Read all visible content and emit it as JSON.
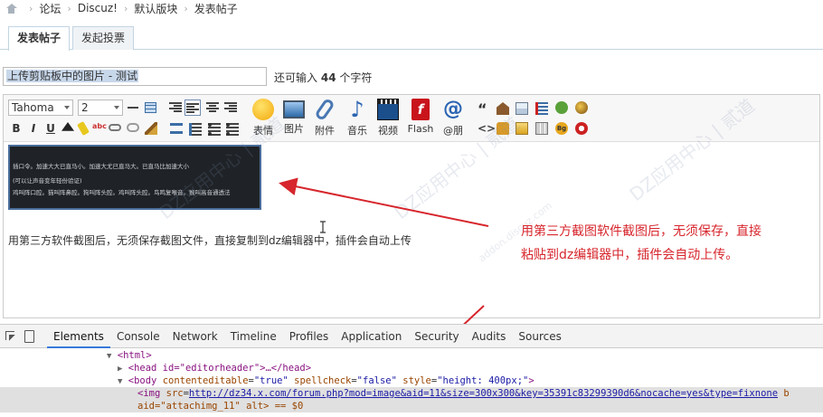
{
  "breadcrumb": {
    "items": [
      "论坛",
      "Discuz!",
      "默认版块",
      "发表帖子"
    ],
    "separator": "›"
  },
  "tabs": [
    {
      "label": "发表帖子",
      "active": true
    },
    {
      "label": "发起投票",
      "active": false
    }
  ],
  "subject": {
    "value": "上传剪贴板中的图片 - 测试",
    "remaining_prefix": "还可输入",
    "remaining_count": "44",
    "remaining_suffix": "个字符"
  },
  "toolbar": {
    "font_family": "Tahoma",
    "font_size": "2",
    "bold": "B",
    "italic": "I",
    "underline": "U",
    "big_buttons": [
      {
        "icon": "smiley-icon",
        "label": "表情"
      },
      {
        "icon": "image-icon",
        "label": "图片"
      },
      {
        "icon": "attachment-icon",
        "label": "附件"
      },
      {
        "icon": "music-icon",
        "label": "音乐"
      },
      {
        "icon": "video-icon",
        "label": "视频"
      },
      {
        "icon": "flash-icon",
        "label": "Flash"
      },
      {
        "icon": "at-icon",
        "label": "@朋"
      }
    ]
  },
  "content": {
    "screenshot_lines": [
      "插口令。加速大大已直马小。加速大尤已直马大。已直马比加速大小",
      "(可以让声音变年轻份验证)",
      "鸡叫阵口腔。猫叫阵鼻腔。狗叫阵头腔。鸡叫阵头腔。鸟鸣复喉音。猴叫高音通透法"
    ],
    "text": "用第三方软件截图后，无须保存截图文件，直接复制到dz编辑器中，插件会自动上传"
  },
  "annotation": {
    "line1": "用第三方截图软件截图后，无须保存，直接",
    "line2": "粘贴到dz编辑器中，插件会自动上传。"
  },
  "watermark": {
    "text": "DZ应用中心 | 贰道",
    "subtext": "addon.discuz.com"
  },
  "devtools": {
    "tabs": [
      "Elements",
      "Console",
      "Network",
      "Timeline",
      "Profiles",
      "Application",
      "Security",
      "Audits",
      "Sources"
    ],
    "active_tab": "Elements",
    "code": {
      "html_open": "<html>",
      "head": "<head id=\"editorheader\">…</head>",
      "body_tag": "body",
      "body_attrs": [
        {
          "name": "contenteditable",
          "value": "\"true\""
        },
        {
          "name": "spellcheck",
          "value": "\"false\""
        },
        {
          "name": "style",
          "value": "\"height: 400px;\""
        }
      ],
      "img_src": "http://dz34.x.com/forum.php?mod=image&aid=11&size=300x300&key=35391c83299390d6&nocache=yes&type=fixnone",
      "img_tail": "b",
      "img_aid": "aid=\"attachimg_11\" alt> == $0"
    }
  },
  "colors": {
    "annotation_red": "#d7262d",
    "tab_border": "#c2d5e3",
    "devtools_active": "#3879d9"
  }
}
